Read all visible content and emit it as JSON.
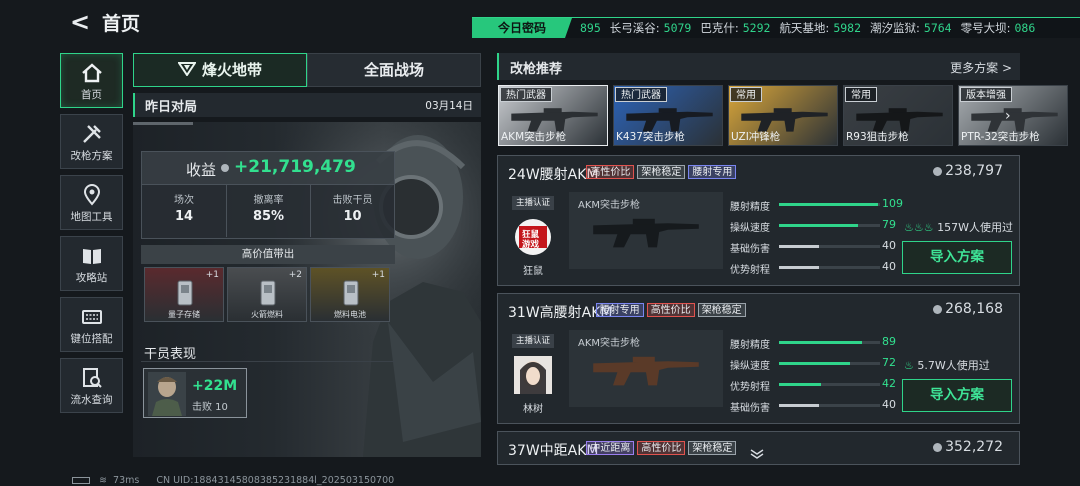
{
  "header": {
    "back_glyph": "<",
    "title": "首页"
  },
  "password": {
    "label": "今日密码",
    "items": [
      {
        "name": "",
        "code": "895"
      },
      {
        "name": "长弓溪谷:",
        "code": "5079"
      },
      {
        "name": "巴克什:",
        "code": "5292"
      },
      {
        "name": "航天基地:",
        "code": "5982"
      },
      {
        "name": "潮汐监狱:",
        "code": "5764"
      },
      {
        "name": "零号大坝:",
        "code": "086"
      }
    ]
  },
  "nav": [
    {
      "label": "首页",
      "icon": "home-icon",
      "active": true
    },
    {
      "label": "改枪方案",
      "icon": "tools-icon",
      "active": false
    },
    {
      "label": "地图工具",
      "icon": "map-pin-icon",
      "active": false
    },
    {
      "label": "攻略站",
      "icon": "book-icon",
      "active": false
    },
    {
      "label": "键位搭配",
      "icon": "keyboard-icon",
      "active": false
    },
    {
      "label": "流水查询",
      "icon": "ledger-search-icon",
      "active": false
    }
  ],
  "mode_tabs": {
    "tab1": "烽火地带",
    "tab2": "全面战场"
  },
  "yesterday": {
    "title": "昨日对局",
    "date": "03月14日",
    "revenue_label": "收益",
    "revenue": "+21,719,479",
    "stats": [
      {
        "label": "场次",
        "value": "14"
      },
      {
        "label": "撤离率",
        "value": "85%"
      },
      {
        "label": "击败干员",
        "value": "10"
      }
    ],
    "hv_title": "高价值带出",
    "items": [
      {
        "name": "量子存储",
        "count": "+1",
        "color": "#5a2a2e"
      },
      {
        "name": "火箭燃料",
        "count": "+2",
        "color": "#4a4d50"
      },
      {
        "name": "燃料电池",
        "count": "+1",
        "color": "#5e5226"
      }
    ],
    "operator_title": "干员表现",
    "operator_value": "+22M",
    "operator_kills": "击败 10"
  },
  "mods": {
    "title": "改枪推荐",
    "more": "更多方案 >",
    "weapons": [
      {
        "tag": "热门武器",
        "name": "AKM突击步枪",
        "bg": "#c9ccd0",
        "gun": "#2b2f33"
      },
      {
        "tag": "热门武器",
        "name": "K437突击步枪",
        "bg": "#2c63b7",
        "gun": "#171b22"
      },
      {
        "tag": "常用",
        "name": "UZI冲锋枪",
        "bg": "#d9a63a",
        "gun": "#1f2226"
      },
      {
        "tag": "常用",
        "name": "R93狙击步枪",
        "bg": "#3a3f44",
        "gun": "#151719"
      },
      {
        "tag": "版本增强",
        "name": "PTR-32突击步枪",
        "bg": "#a8adb1",
        "gun": "#2f3337"
      }
    ],
    "cards": [
      {
        "name": "24W腰射AKM",
        "chips": [
          {
            "t": "高性价比",
            "c": "red"
          },
          {
            "t": "架枪稳定",
            "c": "grey"
          },
          {
            "t": "腰射专用",
            "c": "blue"
          }
        ],
        "price": "238,797",
        "auth": "主播认证",
        "author": "狂鼠",
        "avatar_text": "狂鼠\n游戏",
        "gun": "AKM突击步枪",
        "stats": [
          {
            "label": "腰射精度",
            "value": "109",
            "frac": 0.98,
            "green": true
          },
          {
            "label": "操纵速度",
            "value": "79",
            "frac": 0.78,
            "green": true
          },
          {
            "label": "基础伤害",
            "value": "40",
            "frac": 0.4,
            "green": false
          },
          {
            "label": "优势射程",
            "value": "40",
            "frac": 0.4,
            "green": false
          }
        ],
        "users_icon": "flame-icon",
        "users": "157W人使用过",
        "import": "导入方案"
      },
      {
        "name": "31W高腰射AKM",
        "chips": [
          {
            "t": "腰射专用",
            "c": "blue"
          },
          {
            "t": "高性价比",
            "c": "red"
          },
          {
            "t": "架枪稳定",
            "c": "grey"
          }
        ],
        "price": "268,168",
        "auth": "主播认证",
        "author": "林树",
        "gun": "AKM突击步枪",
        "stats": [
          {
            "label": "腰射精度",
            "value": "89",
            "frac": 0.82,
            "green": true
          },
          {
            "label": "操纵速度",
            "value": "72",
            "frac": 0.7,
            "green": true
          },
          {
            "label": "优势射程",
            "value": "42",
            "frac": 0.42,
            "green": true
          },
          {
            "label": "基础伤害",
            "value": "40",
            "frac": 0.4,
            "green": false
          }
        ],
        "users_icon": "flame-icon",
        "users": "5.7W人使用过",
        "import": "导入方案"
      },
      {
        "name": "37W中距AKM",
        "chips": [
          {
            "t": "中近距离",
            "c": "purple"
          },
          {
            "t": "高性价比",
            "c": "red"
          },
          {
            "t": "架枪稳定",
            "c": "grey"
          }
        ],
        "price": "352,272"
      }
    ]
  },
  "footer": {
    "ping": "73ms",
    "uid": "CN UID:18843145808385231884l_202503150700"
  }
}
